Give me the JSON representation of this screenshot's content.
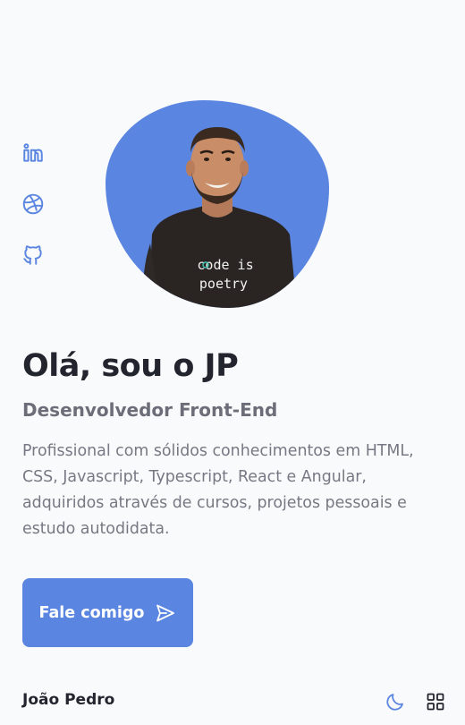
{
  "social": {
    "items": [
      {
        "icon": "linkedin-icon"
      },
      {
        "icon": "dribbble-icon"
      },
      {
        "icon": "github-icon"
      }
    ]
  },
  "profile": {
    "shirt_line1": "code is",
    "shirt_line2": "poetry"
  },
  "hero": {
    "title": "Olá, sou o JP",
    "subtitle": "Desenvolvedor Front-End",
    "description": "Profissional com sólidos conhecimentos em HTML, CSS, Javascript, Typescript, React e Angular, adquiridos através de cursos, projetos pessoais e estudo autodidata.",
    "cta_label": "Fale comigo",
    "cta_icon": "send-icon"
  },
  "footer": {
    "name": "João Pedro",
    "theme_icon": "moon-icon",
    "menu_icon": "grid-menu-icon"
  },
  "colors": {
    "accent": "#5a85e0",
    "text": "#22252e",
    "muted": "#767983",
    "background": "#f9fafc"
  }
}
